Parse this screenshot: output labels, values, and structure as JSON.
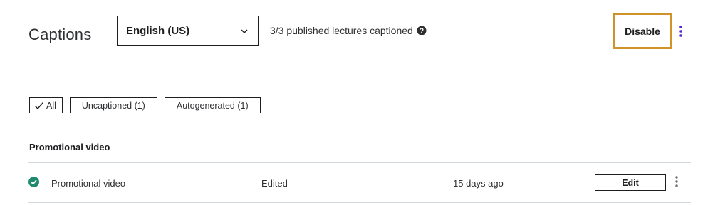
{
  "header": {
    "title": "Captions",
    "language_select": {
      "selected": "English (US)",
      "icon": "chevron-down-icon"
    },
    "status_text": "3/3 published lectures captioned",
    "help_icon": "question-circle-icon",
    "disable_label": "Disable",
    "more_icon": "vertical-ellipsis-icon"
  },
  "filters": [
    {
      "label": "All",
      "active": true,
      "icon": "check-icon"
    },
    {
      "label": "Uncaptioned (1)",
      "active": false
    },
    {
      "label": "Autogenerated (1)",
      "active": false
    }
  ],
  "section": {
    "title": "Promotional video",
    "rows": [
      {
        "status_icon": "check-circle-icon",
        "name": "Promotional video",
        "status": "Edited",
        "time": "15 days ago",
        "edit_label": "Edit",
        "more_icon": "vertical-ellipsis-icon"
      }
    ]
  },
  "colors": {
    "accent_outline": "#d0932a",
    "kebab_purple": "#5624d0",
    "success_green": "#1e8a6e",
    "text": "#1c1d1f",
    "divider": "#d1d7dc"
  }
}
